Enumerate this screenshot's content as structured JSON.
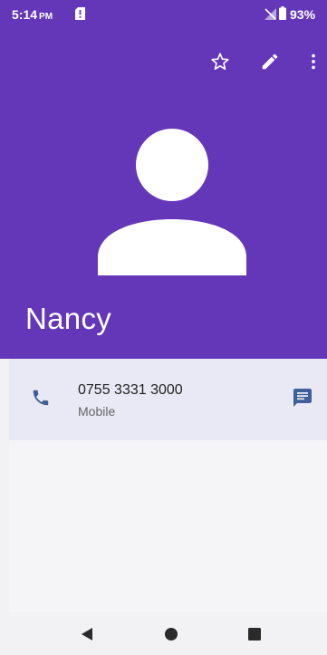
{
  "status_bar": {
    "time": "5:14",
    "ampm": "PM",
    "battery": "93%"
  },
  "header": {
    "background_color": "#6437b8",
    "actions": [
      {
        "icon": "star-outline-icon"
      },
      {
        "icon": "pencil-icon"
      },
      {
        "icon": "more-vert-icon"
      }
    ]
  },
  "contact": {
    "name": "Nancy",
    "avatar_icon": "person-silhouette-icon"
  },
  "phone": {
    "number": "0755 3331 3000",
    "type": "Mobile",
    "accent_color": "#3f5f9a"
  },
  "nav_bar": {
    "buttons": [
      {
        "icon": "back-triangle-icon"
      },
      {
        "icon": "home-circle-icon"
      },
      {
        "icon": "recents-square-icon"
      }
    ]
  }
}
